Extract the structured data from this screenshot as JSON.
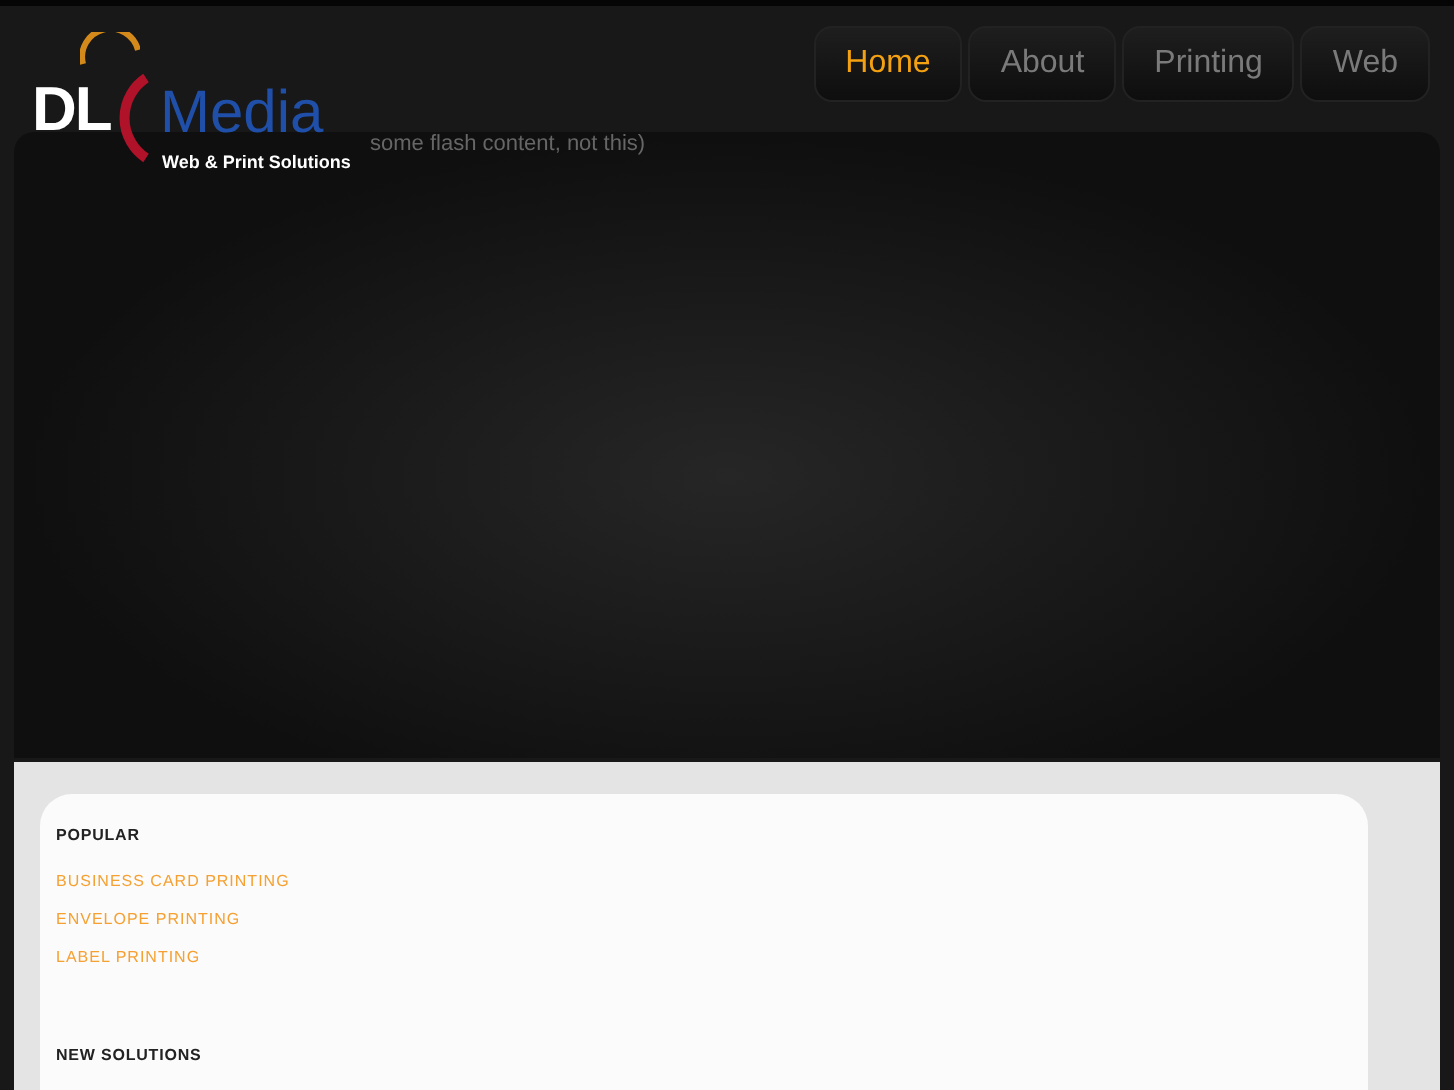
{
  "logo": {
    "initials": "DL",
    "name": "Media",
    "tagline": "Web & Print Solutions"
  },
  "nav": [
    {
      "label": "Home",
      "selected": true
    },
    {
      "label": "About",
      "selected": false
    },
    {
      "label": "Printing",
      "selected": false
    },
    {
      "label": "Web",
      "selected": false
    }
  ],
  "hero": {
    "note": "some flash content, not this)"
  },
  "sections": [
    {
      "heading": "POPULAR",
      "links": [
        "BUSINESS CARD PRINTING",
        "ENVELOPE PRINTING",
        "LABEL PRINTING"
      ]
    },
    {
      "heading": "NEW SOLUTIONS"
    }
  ]
}
